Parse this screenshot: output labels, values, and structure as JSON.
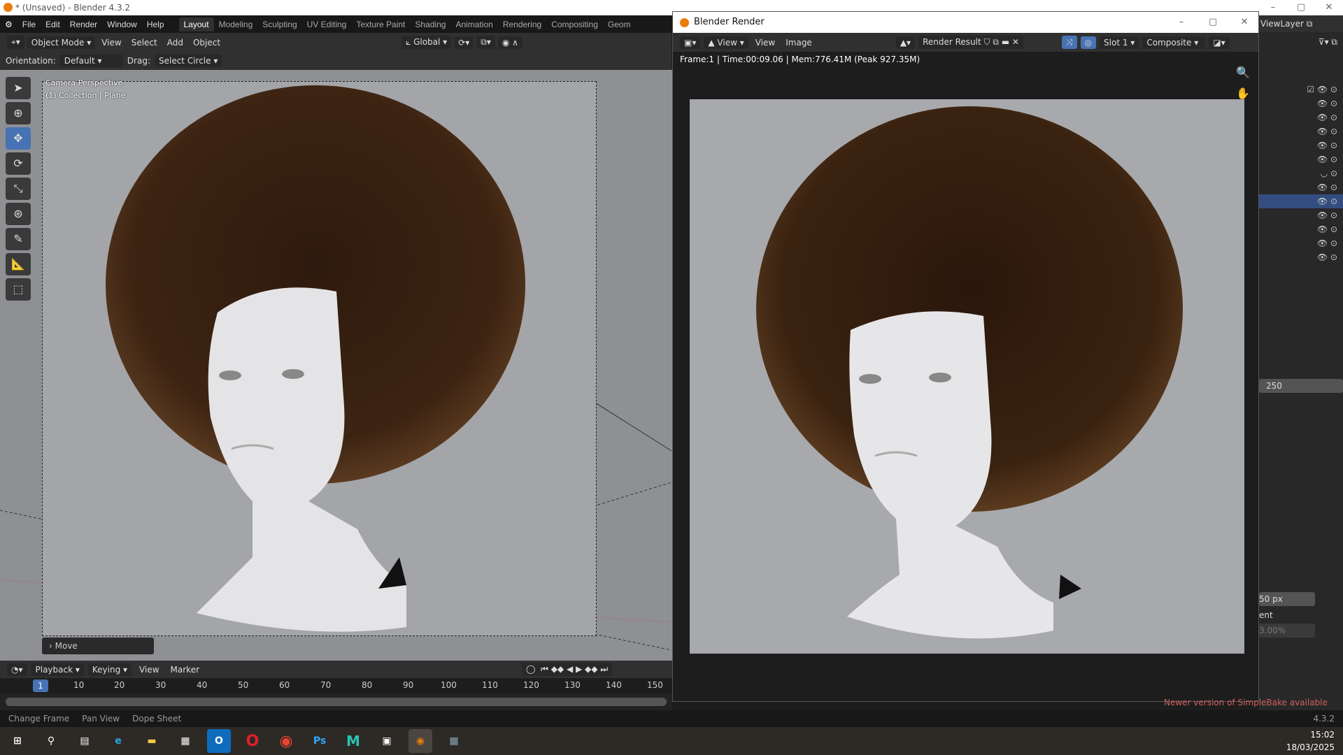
{
  "window": {
    "title": "* (Unsaved) - Blender 4.3.2",
    "minimize": "–",
    "maximize": "▢",
    "close": "✕"
  },
  "menu": [
    "File",
    "Edit",
    "Render",
    "Window",
    "Help"
  ],
  "workspaces": [
    "Layout",
    "Modeling",
    "Sculpting",
    "UV Editing",
    "Texture Paint",
    "Shading",
    "Animation",
    "Rendering",
    "Compositing",
    "Geom"
  ],
  "viewport_header": {
    "mode": "Object Mode",
    "menus": [
      "View",
      "Select",
      "Add",
      "Object"
    ],
    "transform": "Global"
  },
  "tool_settings": {
    "orientation_label": "Orientation:",
    "orientation_value": "Default",
    "drag_label": "Drag:",
    "drag_value": "Select Circle"
  },
  "viewport": {
    "camera": "Camera Perspective",
    "collection": "(1) Collection | Plane",
    "last_op": "Move"
  },
  "timeline": {
    "menus": [
      "Playback",
      "Keying",
      "View",
      "Marker"
    ],
    "current_frame": "1",
    "ticks": [
      "10",
      "20",
      "30",
      "40",
      "50",
      "60",
      "70",
      "80",
      "90",
      "100",
      "110",
      "120",
      "130",
      "140",
      "150"
    ]
  },
  "status": {
    "items": [
      "Change Frame",
      "Pan View",
      "Dope Sheet"
    ],
    "version": "4.3.2",
    "addon_notice": "Newer version of SimpleBake available"
  },
  "render_window": {
    "title": "Blender Render",
    "view1": "View",
    "view2": "View",
    "image": "Image",
    "result": "Render Result",
    "slot": "Slot 1",
    "pass": "Composite",
    "info": "Frame:1 | Time:00:09.06 | Mem:776.41M (Peak 927.35M)"
  },
  "outliner": {
    "viewlayer": "ViewLayer"
  },
  "properties": {
    "end_value": "250",
    "px_value": "50 px",
    "ent_label": "ent",
    "percent": "3.00%"
  },
  "clock": {
    "time": "15:02",
    "date": "18/03/2025"
  }
}
